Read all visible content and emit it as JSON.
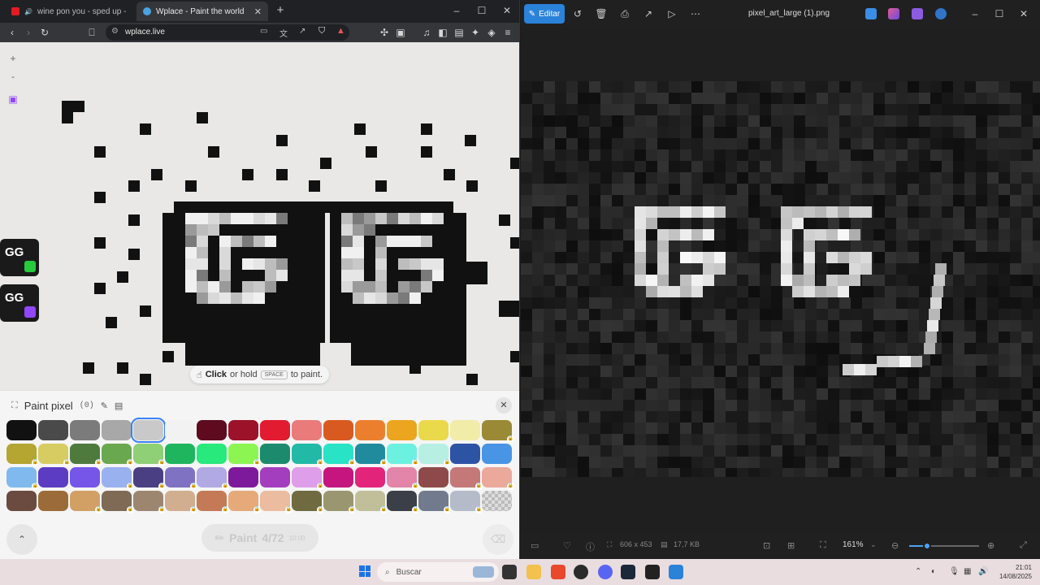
{
  "browser": {
    "tabs": [
      {
        "title": "wine pon you - sped up - YouTub",
        "active": false
      },
      {
        "title": "Wplace - Paint the world",
        "active": true
      }
    ],
    "url": "wplace.live",
    "window_controls": [
      "–",
      "☐",
      "✕"
    ]
  },
  "wplace": {
    "zoom_in": "+",
    "zoom_out": "-",
    "badges": [
      "GG",
      "GG"
    ],
    "hint": {
      "action": "Click",
      "middle": "or hold",
      "key": "SPACE",
      "end": "to paint."
    },
    "panel": {
      "title": "Paint pixel",
      "count": "(0)",
      "paint_button": "Paint",
      "paint_progress": "4/72",
      "paint_timer": "10:00"
    },
    "palette": [
      {
        "color": "#111111",
        "locked": false
      },
      {
        "color": "#4a4a4a",
        "locked": false
      },
      {
        "color": "#7b7b7b",
        "locked": false
      },
      {
        "color": "#a8a8a8",
        "locked": false
      },
      {
        "color": "#c9c9c9",
        "locked": false,
        "selected": true
      },
      {
        "color": "#f2f2f2",
        "locked": false
      },
      {
        "color": "#5e0a1f",
        "locked": false
      },
      {
        "color": "#9b1229",
        "locked": false
      },
      {
        "color": "#e31b31",
        "locked": false
      },
      {
        "color": "#ea7b7b",
        "locked": false
      },
      {
        "color": "#d95a21",
        "locked": false
      },
      {
        "color": "#ec7f2e",
        "locked": false
      },
      {
        "color": "#eca51e",
        "locked": false
      },
      {
        "color": "#ead94b",
        "locked": false
      },
      {
        "color": "#f2eca9",
        "locked": false
      },
      {
        "color": "#9a8a36",
        "locked": true
      },
      {
        "color": "#b5a531",
        "locked": true
      },
      {
        "color": "#d7cc62",
        "locked": true
      },
      {
        "color": "#4f7a3e",
        "locked": true
      },
      {
        "color": "#6aa84f",
        "locked": true
      },
      {
        "color": "#8fcf75",
        "locked": true
      },
      {
        "color": "#1fb55f",
        "locked": false
      },
      {
        "color": "#27e97c",
        "locked": false
      },
      {
        "color": "#8cf552",
        "locked": true
      },
      {
        "color": "#1c8b6d",
        "locked": false
      },
      {
        "color": "#22b9a6",
        "locked": true
      },
      {
        "color": "#28e3c5",
        "locked": true
      },
      {
        "color": "#1f8b9c",
        "locked": true
      },
      {
        "color": "#6cf0e0",
        "locked": true
      },
      {
        "color": "#b7efe3",
        "locked": true
      },
      {
        "color": "#2d53a5",
        "locked": false
      },
      {
        "color": "#4895e5",
        "locked": false
      },
      {
        "color": "#7fb9ee",
        "locked": true
      },
      {
        "color": "#5b3cc2",
        "locked": false
      },
      {
        "color": "#7556e8",
        "locked": false
      },
      {
        "color": "#9ab1ef",
        "locked": true
      },
      {
        "color": "#4b3f84",
        "locked": true
      },
      {
        "color": "#7f72c2",
        "locked": true
      },
      {
        "color": "#b0a9e3",
        "locked": true
      },
      {
        "color": "#7c1a9b",
        "locked": false
      },
      {
        "color": "#a33fbf",
        "locked": false
      },
      {
        "color": "#df9ee9",
        "locked": true
      },
      {
        "color": "#c4167e",
        "locked": false
      },
      {
        "color": "#e3247b",
        "locked": false
      },
      {
        "color": "#e385a8",
        "locked": true
      },
      {
        "color": "#8e4a4a",
        "locked": false
      },
      {
        "color": "#c47878",
        "locked": true
      },
      {
        "color": "#eba99b",
        "locked": true
      },
      {
        "color": "#6b4a3f",
        "locked": false
      },
      {
        "color": "#9c6b3a",
        "locked": false
      },
      {
        "color": "#d2a065",
        "locked": true
      },
      {
        "color": "#7e6a55",
        "locked": true
      },
      {
        "color": "#9d8670",
        "locked": true
      },
      {
        "color": "#d1ae8f",
        "locked": true
      },
      {
        "color": "#c47a56",
        "locked": true
      },
      {
        "color": "#e6a97a",
        "locked": true
      },
      {
        "color": "#ebbc9f",
        "locked": true
      },
      {
        "color": "#6f6a40",
        "locked": true
      },
      {
        "color": "#9a9770",
        "locked": true
      },
      {
        "color": "#c1be9a",
        "locked": true
      },
      {
        "color": "#3b3f47",
        "locked": true
      },
      {
        "color": "#727b8e",
        "locked": true
      },
      {
        "color": "#b6bbca",
        "locked": true
      },
      {
        "color": "transparent",
        "locked": false
      }
    ]
  },
  "viewer": {
    "edit_label": "Editar",
    "file_name": "pixel_art_large (1).png",
    "dimensions": "606 x 453",
    "file_size": "17,7 KB",
    "zoom": "161%",
    "zoom_fraction": 0.25
  },
  "taskbar": {
    "search_placeholder": "Buscar",
    "time": "21:01",
    "date": "14/08/2025"
  },
  "colors": {
    "accent": "#2b82d9",
    "wplace_bg": "#e9e8e6",
    "pixel": "#111111"
  }
}
